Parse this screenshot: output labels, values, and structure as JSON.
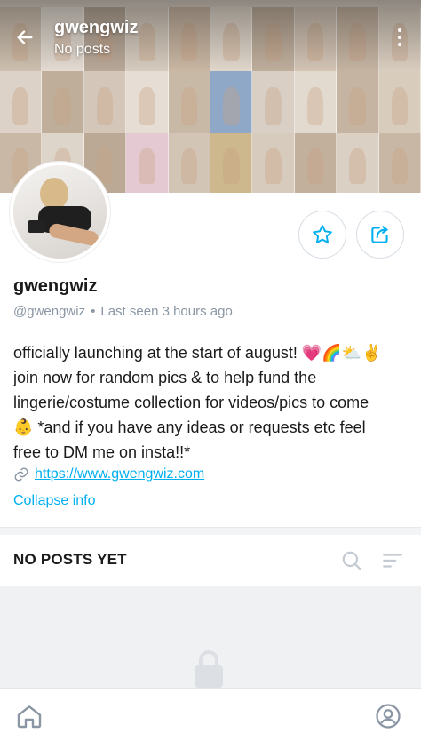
{
  "header": {
    "title": "gwengwiz",
    "subtitle": "No posts"
  },
  "profile": {
    "name": "gwengwiz",
    "handle": "@gwengwiz",
    "separator": "•",
    "last_seen": "Last seen 3 hours ago"
  },
  "bio": {
    "line1": "officially launching at the start of august! 💗🌈⛅✌",
    "line2": "join now for random pics & to help fund the",
    "line3": "lingerie/costume collection for videos/pics to come",
    "line4": "👶 *and if you have any ideas or requests etc feel",
    "line5": "free to DM me on insta!!*"
  },
  "link": {
    "url": "https://www.gwengwiz.com"
  },
  "collapse_label": "Collapse info",
  "posts_section": {
    "heading": "NO POSTS YET"
  },
  "icons": {
    "back": "arrow-left-icon",
    "more": "more-vertical-icon",
    "favorite": "star-icon",
    "share": "share-icon",
    "link": "link-icon",
    "search": "search-icon",
    "sort": "sort-icon",
    "lock": "lock-icon",
    "home": "home-icon",
    "profile": "profile-icon"
  },
  "colors": {
    "accent": "#00aff0",
    "muted": "#8a96a3",
    "text": "#1a1a1a"
  }
}
